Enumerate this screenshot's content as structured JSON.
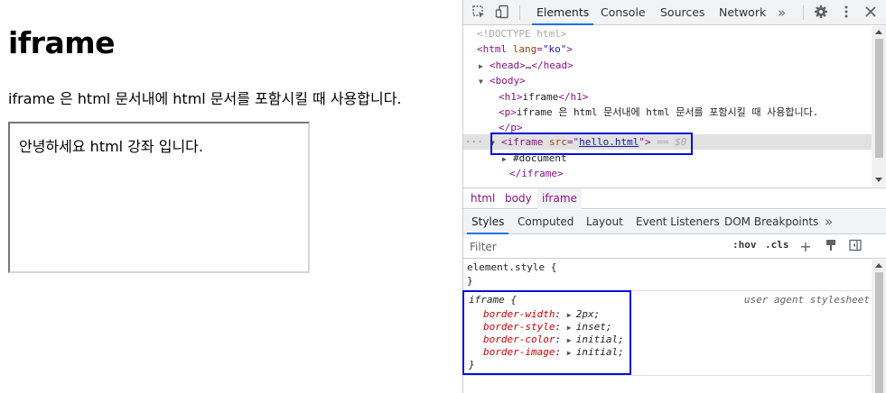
{
  "page": {
    "heading": "iframe",
    "paragraph": "iframe 은 html 문서내에 html 문서를 포함시킬 때 사용합니다.",
    "iframe_content": "안녕하세요 html 강좌 입니다."
  },
  "devtools": {
    "tabs": [
      "Elements",
      "Console",
      "Sources",
      "Network"
    ],
    "more_tabs": "»",
    "tree": {
      "doctype": "<!DOCTYPE html>",
      "html_open_tag": "html",
      "html_attr": "lang",
      "html_attr_val": "\"ko\"",
      "head": "head",
      "head_ellipsis": "…",
      "body": "body",
      "h1_tag": "h1",
      "h1_text": "iframe",
      "p_tag": "p",
      "p_text": "iframe 은 html 문서내에 html 문서를 포함시킬 때 사용합니다.",
      "iframe_tag": "iframe",
      "iframe_attr": "src",
      "iframe_src": "hello.html",
      "selected_marker": "== $0",
      "document": "#document",
      "row_dots": "···"
    },
    "breadcrumbs": [
      "html",
      "body",
      "iframe"
    ],
    "lower_tabs": [
      "Styles",
      "Computed",
      "Layout",
      "Event Listeners",
      "DOM Breakpoints"
    ],
    "filter_placeholder": "Filter",
    "filter_buttons": [
      ":hov",
      ".cls"
    ],
    "styles": {
      "element_style": "element.style {",
      "close_brace": "}",
      "rule_selector": "iframe {",
      "rule_source": "user agent stylesheet",
      "properties": [
        {
          "name": "border-width",
          "value": "2px;"
        },
        {
          "name": "border-style",
          "value": "inset;"
        },
        {
          "name": "border-color",
          "value": "initial;"
        },
        {
          "name": "border-image",
          "value": "initial;"
        }
      ]
    },
    "colors": {
      "accent": "#1a73e8",
      "highlight_box": "#0010d6",
      "tag": "#881280",
      "attr": "#994500",
      "attr_value": "#1a1aa6",
      "property": "#c80000"
    }
  }
}
